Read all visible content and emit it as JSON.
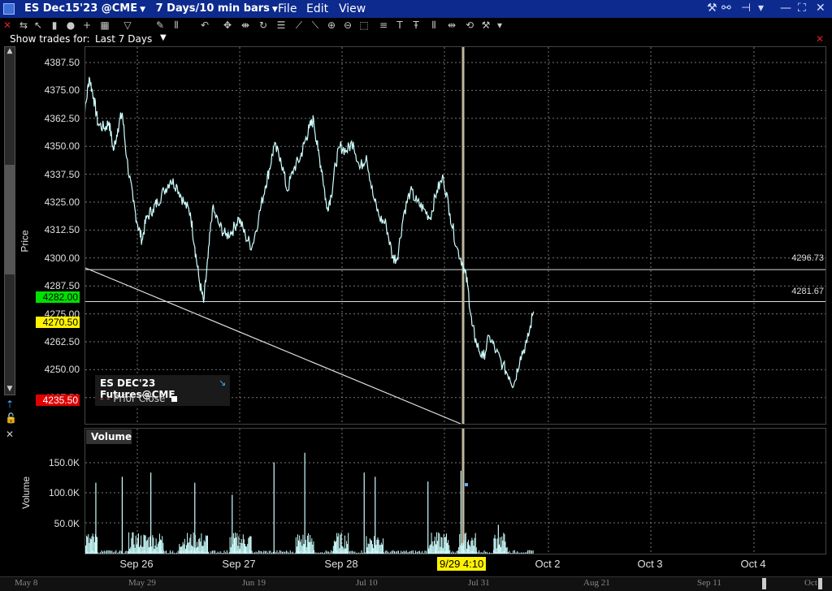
{
  "window": {
    "title": "ES Dec15'23 @CME",
    "period": "7 Days/10 min bars",
    "menus": [
      "File",
      "Edit",
      "View"
    ]
  },
  "trades_filter": {
    "label": "Show trades for:",
    "value": "Last 7 Days"
  },
  "price_axis": {
    "label": "Price",
    "ticks": [
      "4387.50",
      "4375.00",
      "4362.50",
      "4350.00",
      "4337.50",
      "4325.00",
      "4312.50",
      "4300.00",
      "4287.50",
      "4275.00",
      "4262.50",
      "4250.00",
      "4237.50"
    ]
  },
  "price_tags": {
    "green": "4282.00",
    "yellow": "4270.50",
    "red": "4235.50"
  },
  "lines": {
    "upper_label": "4296.73",
    "lower_label": "4281.67"
  },
  "legend": {
    "title": "ES DEC'23 Futures@CME",
    "item": "Prior Close"
  },
  "volume_axis": {
    "label": "Volume",
    "ticks": [
      "150.0K",
      "100.0K",
      "50.0K"
    ],
    "panel_title": "Volume"
  },
  "x_axis": {
    "ticks": [
      "Sep 26",
      "Sep 27",
      "Sep 28",
      "Sep 29",
      "Oct 2",
      "Oct 3",
      "Oct 4"
    ]
  },
  "cursor_label": "9/29 4:10",
  "navigator": {
    "labels": [
      "May 8",
      "May 29",
      "Jun 19",
      "Jul 10",
      "Jul 31",
      "Aug 21",
      "Sep 11",
      "Oct"
    ]
  },
  "colors": {
    "series": "#cfffff",
    "accent_title": "#0d2a8e",
    "green_tag": "#00e000",
    "yellow_tag": "#fff200",
    "red_tag": "#e00000"
  },
  "chart_data": {
    "type": "line",
    "x_labels": [
      "Sep 26",
      "Sep 27",
      "Sep 28",
      "Sep 29",
      "Oct 2",
      "Oct 3",
      "Oct 4"
    ],
    "y_range": [
      4237.5,
      4387.5
    ],
    "price_path": [
      [
        0,
        4372
      ],
      [
        0.02,
        4365
      ],
      [
        0.04,
        4381
      ],
      [
        0.06,
        4372
      ],
      [
        0.08,
        4360
      ],
      [
        0.11,
        4358
      ],
      [
        0.13,
        4361
      ],
      [
        0.15,
        4348
      ],
      [
        0.17,
        4358
      ],
      [
        0.19,
        4365
      ],
      [
        0.21,
        4345
      ],
      [
        0.24,
        4325
      ],
      [
        0.26,
        4315
      ],
      [
        0.28,
        4308
      ],
      [
        0.3,
        4318
      ],
      [
        0.33,
        4322
      ],
      [
        0.35,
        4325
      ],
      [
        0.38,
        4330
      ],
      [
        0.41,
        4335
      ],
      [
        0.44,
        4332
      ],
      [
        0.47,
        4325
      ],
      [
        0.5,
        4320
      ],
      [
        0.52,
        4305
      ],
      [
        0.54,
        4290
      ],
      [
        0.56,
        4280
      ],
      [
        0.58,
        4300
      ],
      [
        0.6,
        4322
      ],
      [
        0.63,
        4315
      ],
      [
        0.66,
        4310
      ],
      [
        0.69,
        4312
      ],
      [
        0.72,
        4318
      ],
      [
        0.75,
        4310
      ],
      [
        0.78,
        4305
      ],
      [
        0.81,
        4318
      ],
      [
        0.84,
        4332
      ],
      [
        0.86,
        4340
      ],
      [
        0.88,
        4350
      ],
      [
        0.91,
        4345
      ],
      [
        0.94,
        4330
      ],
      [
        0.97,
        4340
      ],
      [
        1.0,
        4345
      ],
      [
        1.02,
        4352
      ],
      [
        1.04,
        4358
      ],
      [
        1.06,
        4362
      ],
      [
        1.08,
        4348
      ],
      [
        1.1,
        4338
      ],
      [
        1.12,
        4322
      ],
      [
        1.14,
        4328
      ],
      [
        1.16,
        4342
      ],
      [
        1.18,
        4350
      ],
      [
        1.21,
        4348
      ],
      [
        1.24,
        4352
      ],
      [
        1.27,
        4340
      ],
      [
        1.3,
        4346
      ],
      [
        1.33,
        4328
      ],
      [
        1.36,
        4318
      ],
      [
        1.39,
        4315
      ],
      [
        1.42,
        4300
      ],
      [
        1.44,
        4300
      ],
      [
        1.47,
        4320
      ],
      [
        1.5,
        4330
      ],
      [
        1.53,
        4325
      ],
      [
        1.56,
        4322
      ],
      [
        1.59,
        4318
      ],
      [
        1.62,
        4330
      ],
      [
        1.65,
        4336
      ],
      [
        1.68,
        4320
      ],
      [
        1.71,
        4305
      ],
      [
        1.74,
        4297
      ],
      [
        1.76,
        4288
      ],
      [
        1.78,
        4270
      ],
      [
        1.8,
        4262
      ],
      [
        1.83,
        4255
      ],
      [
        1.86,
        4265
      ],
      [
        1.89,
        4258
      ],
      [
        1.92,
        4252
      ],
      [
        1.95,
        4247
      ],
      [
        1.97,
        4243
      ],
      [
        2.0,
        4256
      ],
      [
        2.03,
        4262
      ],
      [
        2.06,
        4276
      ]
    ],
    "volume_spikes": [
      [
        0.02,
        105
      ],
      [
        0.07,
        118
      ],
      [
        0.19,
        128
      ],
      [
        0.32,
        135
      ],
      [
        0.52,
        118
      ],
      [
        0.69,
        98
      ],
      [
        0.88,
        152
      ],
      [
        1.02,
        168
      ],
      [
        1.29,
        135
      ],
      [
        1.34,
        128
      ],
      [
        1.58,
        120
      ],
      [
        1.73,
        138
      ],
      [
        1.9,
        48
      ]
    ]
  }
}
